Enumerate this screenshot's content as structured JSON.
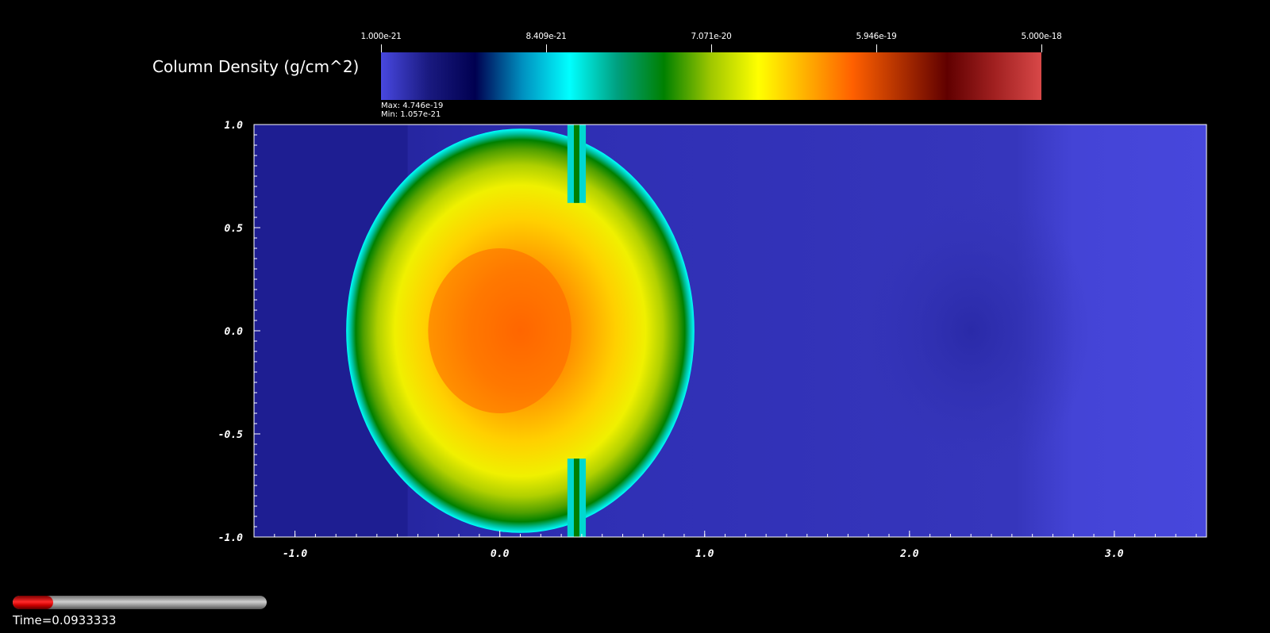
{
  "colorbar": {
    "title": "Column Density (g/cm^2)",
    "tick_labels": [
      "1.000e-21",
      "8.409e-21",
      "7.071e-20",
      "5.946e-19",
      "5.000e-18"
    ],
    "max_label": "Max:  4.746e-19",
    "min_label": "Min:  1.057e-21",
    "colors": [
      "#4848e0",
      "#1a1a80",
      "#000050",
      "#0090c0",
      "#00ffff",
      "#00a080",
      "#008000",
      "#a0c800",
      "#ffff00",
      "#ffb000",
      "#ff6000",
      "#b03000",
      "#600000",
      "#a02020",
      "#d84848"
    ]
  },
  "chart_data": {
    "type": "heatmap",
    "title": "",
    "colorbar_label": "Column Density (g/cm^2)",
    "colorbar_range": [
      1e-21,
      5e-18
    ],
    "colorbar_scale": "log",
    "data_max": 4.746e-19,
    "data_min": 1.057e-21,
    "xlim": [
      -1.2,
      3.45
    ],
    "ylim": [
      -1.0,
      1.0
    ],
    "x_ticks": [
      -1.0,
      0.0,
      1.0,
      2.0,
      3.0
    ],
    "x_tick_labels": [
      "-1.0",
      "0.0",
      "1.0",
      "2.0",
      "3.0"
    ],
    "y_ticks": [
      1.0,
      0.5,
      0.0,
      -0.5,
      -1.0
    ],
    "y_tick_labels": [
      "1.0",
      "0.5",
      "0.0",
      "-0.5",
      "-1.0"
    ],
    "features": {
      "cloud_center": [
        0.0,
        0.0
      ],
      "cloud_left_edge_x": -0.75,
      "cloud_right_edge_x": 0.95,
      "cloud_radius_y": 0.98,
      "cloud_peak_value": 4.746e-19,
      "background_value": 2e-21
    }
  },
  "time": {
    "label": "Time=0.0933333",
    "progress": 0.16
  }
}
